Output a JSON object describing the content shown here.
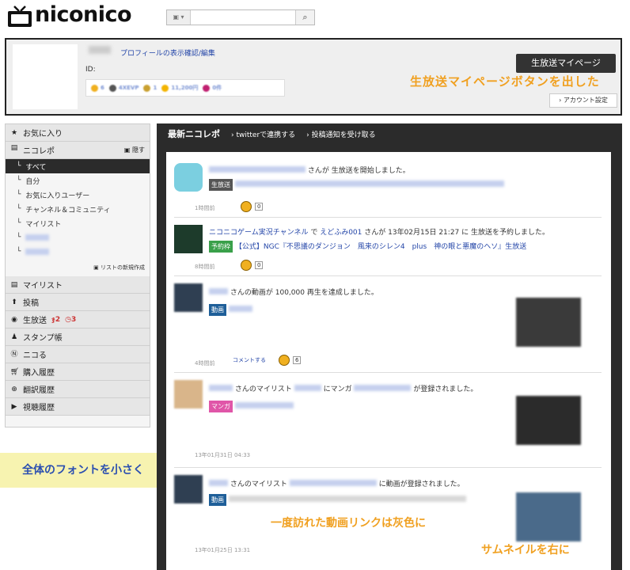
{
  "header": {
    "logo": "niconico",
    "search_placeholder": ""
  },
  "profile": {
    "link": "プロフィールの表示確認/編集",
    "id_label": "ID:",
    "stats": [
      "6",
      "4XEVP",
      "1",
      "11,200円",
      "0件"
    ],
    "live_button": "生放送マイページ",
    "account_button": "アカウント設定",
    "annotation": "生放送マイページボタンを出した"
  },
  "sidebar": {
    "favorites": "お気に入り",
    "nicorepo": "ニコレポ",
    "hide": "隠す",
    "subs": [
      "すべて",
      "自分",
      "お気に入りユーザー",
      "チャンネル＆コミュニティ",
      "マイリスト",
      "",
      ""
    ],
    "new_list": "リストの新規作成",
    "items": [
      "マイリスト",
      "投稿",
      "生放送",
      "スタンプ帳",
      "ニコる",
      "購入履歴",
      "翻訳履歴",
      "視聴履歴"
    ],
    "live_counts": [
      "2",
      "3"
    ]
  },
  "annot_font": "全体のフォントを小さく",
  "main": {
    "tabs": [
      "最新ニコレポ",
      "twitterで連携する",
      "投稿通知を受け取る"
    ],
    "entries": [
      {
        "text": "さんが 生放送を開始しました。",
        "tag": "生放送",
        "time": "1時間前",
        "count": "0"
      },
      {
        "text_a": "ニコニコゲーム実況チャンネル",
        "text_b": " で ",
        "text_c": "えどふみ001",
        "text_d": " さんが 13年02月15日 21:27 に 生放送を予約しました。",
        "tag": "予約枠",
        "title": "【公式】NGC『不思議のダンジョン　風来のシレン4　plus　神の眼と悪魔のヘソ』生放送",
        "time": "8時間前",
        "count": "0"
      },
      {
        "text": "さんの動画が 100,000 再生を達成しました。",
        "tag": "動画",
        "time": "4時間前",
        "comment": "コメントする",
        "count": "6"
      },
      {
        "text_a": "さんのマイリスト ",
        "text_b": " にマンガ ",
        "text_c": " が登録されました。",
        "tag": "マンガ",
        "time": "13年01月31日 04:33"
      },
      {
        "text_a": "さんのマイリスト ",
        "text_b": " に動画が登録されました。",
        "tag": "動画",
        "time": "13年01月25日 13:31"
      }
    ],
    "annot_visited": "一度訪れた動画リンクは灰色に",
    "annot_thumb": "サムネイルを右に"
  },
  "colors": {
    "accent": "#f0a020",
    "dark": "#2b2b2b",
    "link": "#2446a8"
  }
}
